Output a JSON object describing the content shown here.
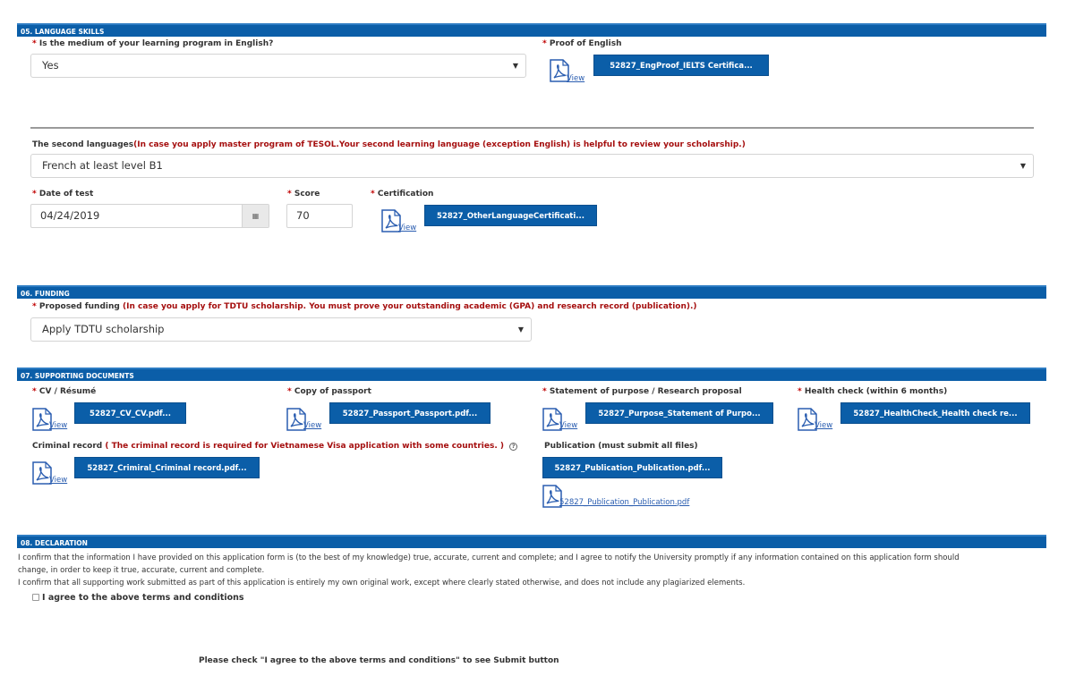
{
  "language": {
    "header": "05. LANGUAGE SKILLS",
    "medium_label": "Is the medium of your learning program in English?",
    "medium_value": "Yes",
    "proof_label": "Proof of English",
    "proof_file": "52827_EngProof_IELTS Certifica...",
    "view_label": "View",
    "second_label": "The second languages",
    "second_note": "(In case you apply master program of TESOL.Your second learning language (exception English) is helpful to review your scholarship.)",
    "second_value": "French at least level B1",
    "date_label": "Date of test",
    "date_value": "04/24/2019",
    "score_label": "Score",
    "score_value": "70",
    "cert_label": "Certification",
    "cert_file": "52827_OtherLanguageCertificati...",
    "required_mark": "*"
  },
  "funding": {
    "header": "06. FUNDING",
    "label": "Proposed funding",
    "note": "(In case you apply for TDTU scholarship. You must prove your outstanding academic (GPA) and research record (publication).)",
    "value": "Apply TDTU scholarship"
  },
  "documents": {
    "header": "07. SUPPORTING DOCUMENTS",
    "cv_label": "CV / Résumé",
    "cv_file": "52827_CV_CV.pdf...",
    "passport_label": "Copy of passport",
    "passport_file": "52827_Passport_Passport.pdf...",
    "purpose_label": "Statement of purpose / Research proposal",
    "purpose_file": "52827_Purpose_Statement of Purpo...",
    "health_label": "Health check (within 6 months)",
    "health_file": "52827_HealthCheck_Health check re...",
    "criminal_label": "Criminal record",
    "criminal_note": "( The criminal record is required for Vietnamese Visa application with some countries. )",
    "criminal_file": "52827_Crimiral_Criminal record.pdf...",
    "publication_label": "Publication (must submit all files)",
    "publication_file": "52827_Publication_Publication.pdf...",
    "publication_link": "52827_Publication_Publication.pdf"
  },
  "declaration": {
    "header": "08. DECLARATION",
    "line1": "I confirm that the information I have provided on this application form is (to the best of my knowledge) true, accurate, current and complete; and I agree to notify the University promptly if any information contained on this application form should",
    "line2": "change, in order to keep it true, accurate, current and complete.",
    "line3": "I confirm that all supporting work submitted as part of this application is entirely my own original work, except where clearly stated otherwise, and does not include any plagiarized elements.",
    "agree_label": "I agree to the above terms and conditions",
    "submit_hint": "Please check \"I agree to the above terms and conditions\" to see Submit button"
  },
  "colors": {
    "header_bg": "#0b5ea8",
    "required": "#c00000",
    "note": "#a50f0f",
    "link": "#2a5db0"
  },
  "icons": [
    "pdf-icon",
    "calendar-icon",
    "help-icon",
    "caret-down-icon"
  ]
}
